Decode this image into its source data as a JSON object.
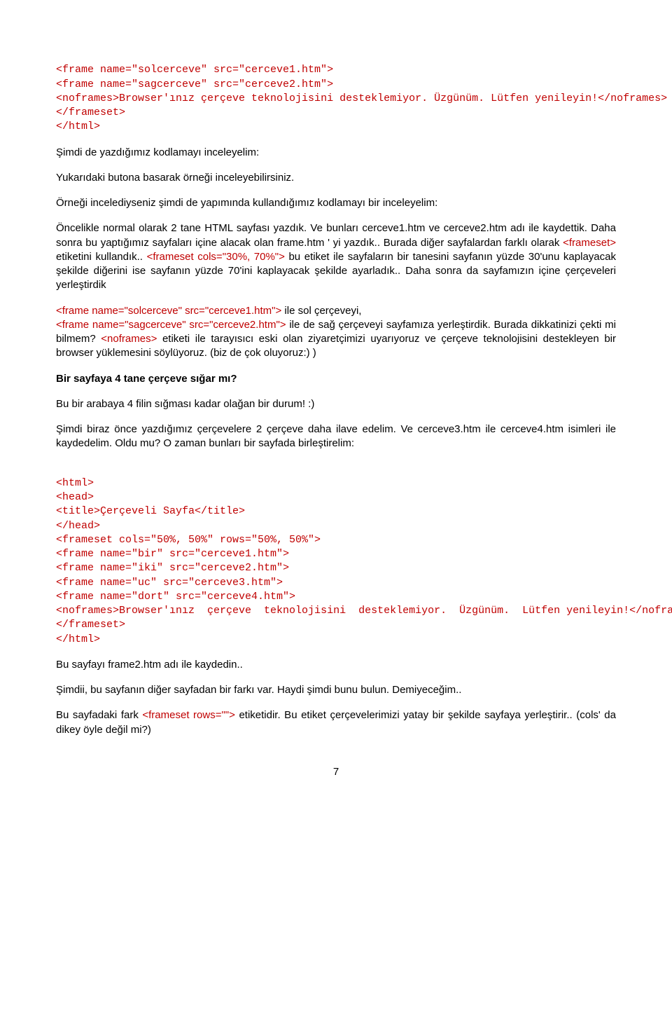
{
  "code1": {
    "l1": "<frame name=\"solcerceve\" src=\"cerceve1.htm\">",
    "l2": "<frame name=\"sagcerceve\" src=\"cerceve2.htm\">",
    "l3a": "<noframes>",
    "l3b": "Browser'ınız çerçeve teknolojisini desteklemiyor. Üzgünüm. Lütfen yenileyin!",
    "l3c": "</noframes>",
    "l4": "</frameset>",
    "l5": "</html>"
  },
  "p1": "Şimdi de yazdığımız kodlamayı inceleyelim:",
  "p2": "Yukarıdaki butona basarak örneği inceleyebilirsiniz.",
  "p3": "Örneği incelediyseniz şimdi de yapımında kullandığımız kodlamayı bir inceleyelim:",
  "p4a": "Öncelikle normal olarak 2 tane HTML sayfası yazdık. Ve bunları cerceve1.htm ve cerceve2.htm adı ile kaydettik. Daha sonra bu yaptığımız sayfaları içine alacak olan frame.htm ' yi yazdık.. Burada diğer sayfalardan farklı olarak ",
  "p4b": "<frameset>",
  "p4c": " etiketini kullandık.. ",
  "p4d": "<frameset cols=\"30%, 70%\">",
  "p4e": " bu etiket ile sayfaların bir tanesini sayfanın yüzde 30'unu kaplayacak şekilde diğerini ise sayfanın yüzde 70'ini kaplayacak şekilde ayarladık.. Daha sonra da sayfamızın içine çerçeveleri yerleştirdik",
  "p5a": "<frame name=\"solcerceve\" src=\"cerceve1.htm\">",
  "p5b": " ile sol çerçeveyi,",
  "p6a": "<frame name=\"sagcerceve\" src=\"cerceve2.htm\">",
  "p6b": " ile de sağ çerçeveyi sayfamıza yerleştirdik. Burada dikkatinizi çekti mi bilmem? ",
  "p6c": "<noframes>",
  "p6d": " etiketi ile tarayısıcı eski olan ziyaretçimizi uyarıyoruz ve çerçeve teknolojisini destekleyen bir browser yüklemesini söylüyoruz. (biz de çok oluyoruz:) )",
  "h1": "Bir sayfaya 4 tane çerçeve sığar mı?",
  "p7": "Bu bir arabaya 4 filin sığması kadar olağan bir durum! :)",
  "p8": "Şimdi biraz önce yazdığımız çerçevelere 2 çerçeve daha ilave edelim. Ve cerceve3.htm ile cerceve4.htm isimleri ile kaydedelim. Oldu mu? O zaman bunları bir sayfada birleştirelim:",
  "code2": {
    "l1": "<html>",
    "l2": "<head>",
    "l3": "<title>Çerçeveli Sayfa</title>",
    "l4": "</head>",
    "l5": "<frameset cols=\"50%, 50%\" rows=\"50%, 50%\">",
    "l6": "<frame name=\"bir\" src=\"cerceve1.htm\">",
    "l7": "<frame name=\"iki\" src=\"cerceve2.htm\">",
    "l8": "<frame name=\"uc\" src=\"cerceve3.htm\">",
    "l9": "<frame name=\"dort\" src=\"cerceve4.htm\">",
    "l10a": "<noframes>",
    "l10b": "Browser'ınız  çerçeve  teknolojisini  desteklemiyor.  Üzgünüm.  Lütfen yenileyin!",
    "l10c": "</noframes>",
    "l11": "</frameset>",
    "l12": "</html>"
  },
  "p9": "Bu sayfayı frame2.htm adı ile kaydedin..",
  "p10": "Şimdii, bu sayfanın diğer sayfadan bir farkı var. Haydi şimdi bunu bulun. Demiyeceğim..",
  "p11a": "Bu sayfadaki fark ",
  "p11b": "<frameset rows=\"\">",
  "p11c": " etiketidir. Bu etiket çerçevelerimizi yatay bir şekilde sayfaya yerleştirir.. (cols' da dikey öyle değil mi?)",
  "pagenum": "7"
}
